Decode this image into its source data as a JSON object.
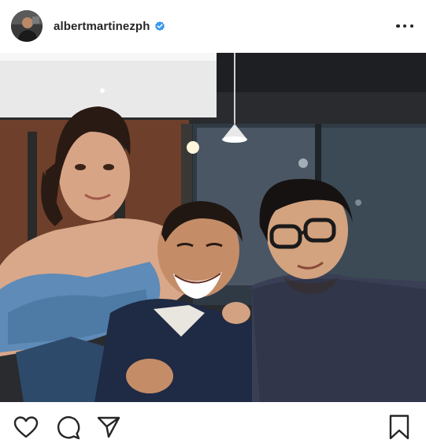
{
  "post": {
    "username": "albertmartinezph",
    "verified": true,
    "photo": "group photo of three people smiling at a restaurant",
    "icons": {
      "more": "more-options-icon",
      "like": "heart-icon",
      "comment": "comment-icon",
      "share": "share-icon",
      "save": "bookmark-icon"
    }
  },
  "colors": {
    "text": "#262626",
    "verified_blue": "#3897f0",
    "background": "#ffffff"
  }
}
